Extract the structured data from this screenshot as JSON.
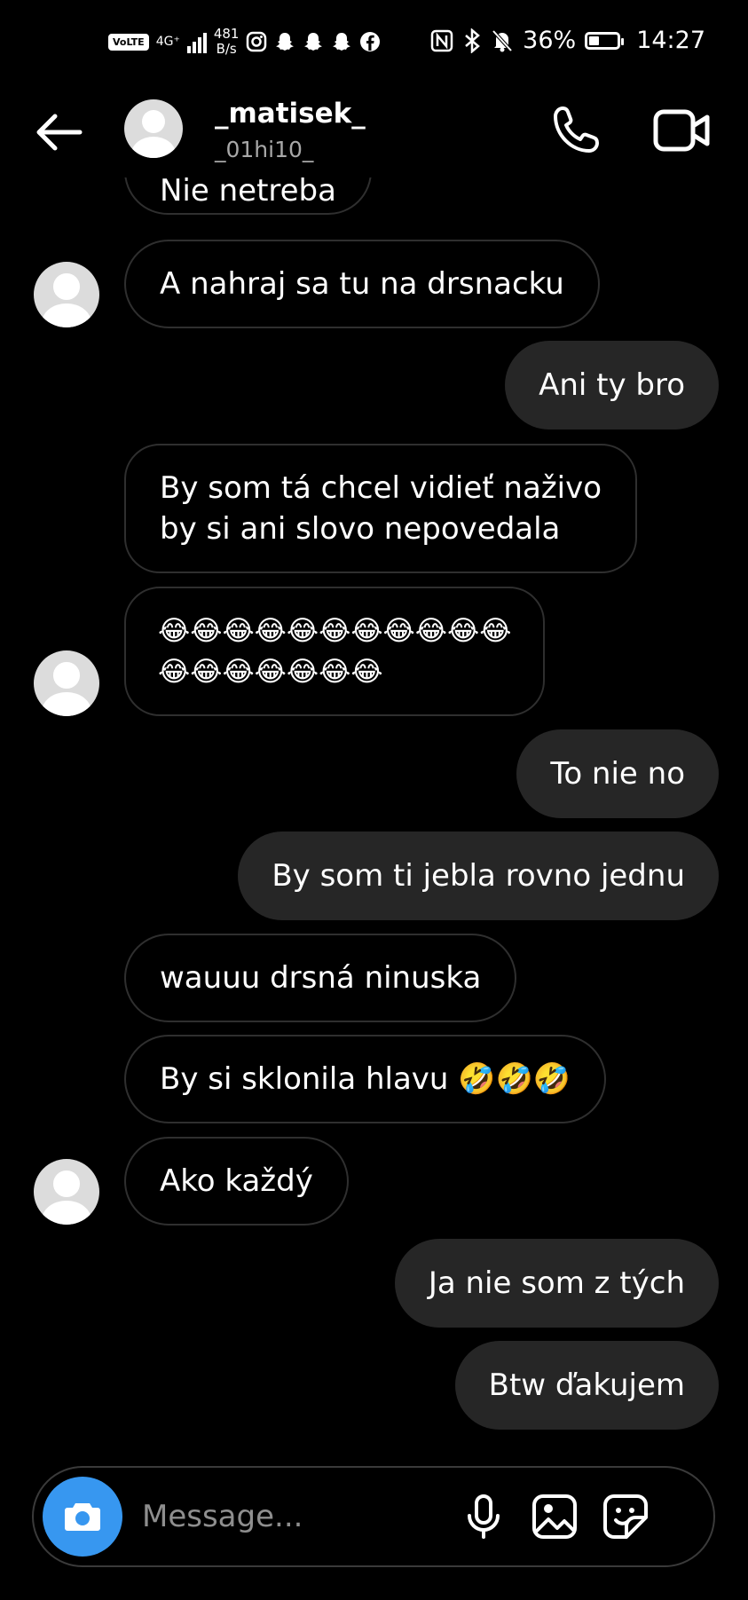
{
  "status_bar": {
    "volte": "VoLTE",
    "network": "4G⁺",
    "speed_value": "481",
    "speed_unit": "B/s",
    "battery": "36%",
    "battery_level": 0.36,
    "time": "14:27",
    "left_icons": [
      "instagram-icon",
      "snapchat-icon",
      "snapchat-icon",
      "snapchat-icon",
      "facebook-icon"
    ],
    "right_icons": [
      "nfc-icon",
      "bluetooth-icon",
      "mute-bell-icon",
      "battery-icon"
    ]
  },
  "header": {
    "name": "_matisek_",
    "handle": "_01hi10_"
  },
  "messages": [
    {
      "side": "in",
      "text": "Nie netreba"
    },
    {
      "side": "in",
      "text": "A nahraj sa tu na drsnacku"
    },
    {
      "side": "out",
      "text": "Ani ty bro"
    },
    {
      "side": "in",
      "lines": [
        "By som tá chcel vidieť naživo",
        "by si ani slovo nepovedala"
      ]
    },
    {
      "side": "in",
      "lines": [
        "😂😂😂😂😂😂😂😂😂😂😂",
        "😂😂😂😂😂😂😂"
      ]
    },
    {
      "side": "out",
      "text": "To nie no"
    },
    {
      "side": "out",
      "text": "By som ti jebla rovno jednu"
    },
    {
      "side": "in",
      "text": "wauuu drsná ninuska"
    },
    {
      "side": "in",
      "text": "By si sklonila hlavu 🤣🤣🤣"
    },
    {
      "side": "in",
      "text": "Ako každý"
    },
    {
      "side": "out",
      "text": "Ja nie som z tých"
    },
    {
      "side": "out",
      "text": "Btw ďakujem"
    }
  ],
  "composer": {
    "placeholder": "Message..."
  },
  "colors": {
    "background": "#000000",
    "outgoing_bubble": "#262626",
    "incoming_border": "#2f2f2f",
    "camera_button": "#3797f0",
    "muted_text": "#a8a8a8"
  }
}
